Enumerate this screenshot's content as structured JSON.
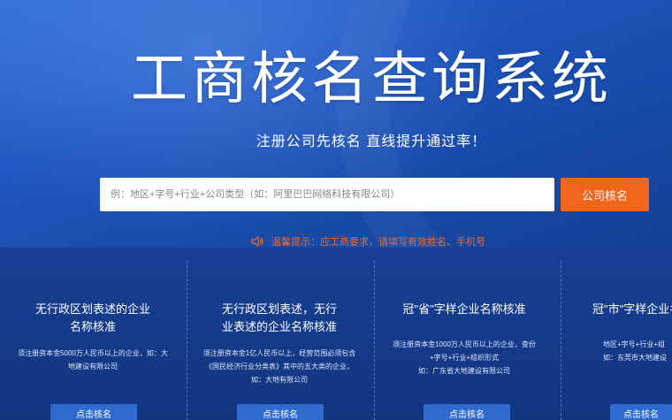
{
  "hero": {
    "title": "工商核名查询系统",
    "subtitle": "注册公司先核名 直线提升通过率！",
    "search_placeholder": "例：地区+字号+行业+公司类型（如：阿里巴巴网络科技有限公司）",
    "search_button": "公司核名"
  },
  "tip": {
    "icon": "speaker-icon",
    "text": "温馨提示：应工商要求，请填写有效姓名、手机号"
  },
  "cards": [
    {
      "title_line1": "无行政区划表述的企业",
      "title_line2": "名称核准",
      "desc_line1": "须注册资本金5000万人民币以上的企业，如：大",
      "desc_line2": "地建设有限公司",
      "desc_line3": "",
      "button": "点击核名"
    },
    {
      "title_line1": "无行政区划表述，无行",
      "title_line2": "业表述的企业名称核准",
      "desc_line1": "须注册资本金1亿人民币以上，经营范围必须包含",
      "desc_line2": "《国民经济行业分类表》其中的五大类的企业，",
      "desc_line3": "如：大地有限公司",
      "button": "点击核名"
    },
    {
      "title_line1": "冠\"省\"字样企业名称核准",
      "title_line2": "",
      "desc_line1": "须注册资本金1000万人民币以上的企业，查份",
      "desc_line2": "+字号+行业+组织形式",
      "desc_line3": "如：广东省大地建设有限公司",
      "button": "点击核名"
    },
    {
      "title_line1": "冠\"市\"字样企业名",
      "title_line2": "",
      "desc_line1": "地区+字号+行业+组",
      "desc_line2": "如：东莞市大地建设",
      "desc_line3": "",
      "button": "点击核名"
    }
  ]
}
